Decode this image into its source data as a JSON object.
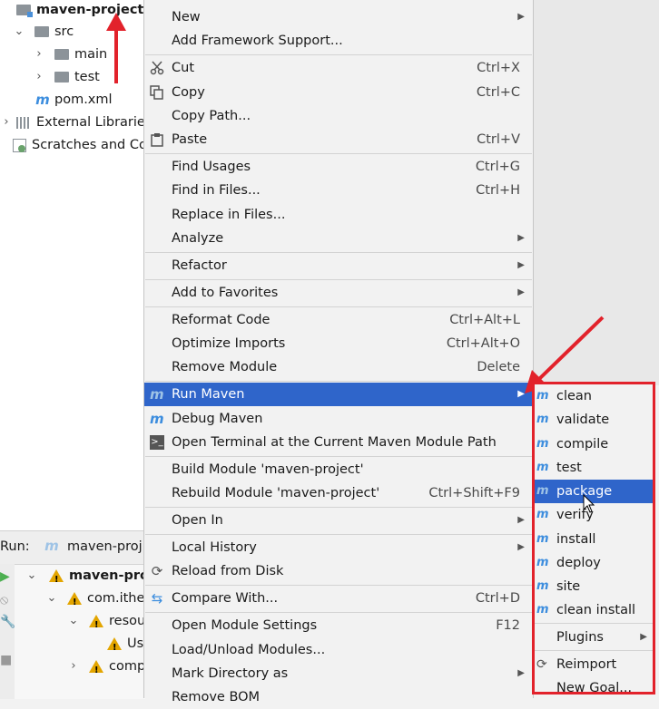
{
  "project_tree": {
    "root": "maven-project",
    "items": [
      {
        "label": "src"
      },
      {
        "label": "main"
      },
      {
        "label": "test"
      },
      {
        "label": "pom.xml"
      },
      {
        "label": "External Librarie"
      },
      {
        "label": "Scratches and Co"
      }
    ]
  },
  "run_panel": {
    "run_label": "Run:",
    "tab_label": "maven-proj",
    "tree": [
      "maven-pro",
      "com.ithe",
      "resou",
      "Us",
      "comp"
    ]
  },
  "context_menu": {
    "items": [
      {
        "label": "New",
        "shortcut": ""
      },
      {
        "label": "Add Framework Support...",
        "shortcut": ""
      },
      {
        "label": "Cut",
        "shortcut": "Ctrl+X"
      },
      {
        "label": "Copy",
        "shortcut": "Ctrl+C"
      },
      {
        "label": "Copy Path...",
        "shortcut": ""
      },
      {
        "label": "Paste",
        "shortcut": "Ctrl+V"
      },
      {
        "label": "Find Usages",
        "shortcut": "Ctrl+G"
      },
      {
        "label": "Find in Files...",
        "shortcut": "Ctrl+H"
      },
      {
        "label": "Replace in Files...",
        "shortcut": ""
      },
      {
        "label": "Analyze",
        "shortcut": ""
      },
      {
        "label": "Refactor",
        "shortcut": ""
      },
      {
        "label": "Add to Favorites",
        "shortcut": ""
      },
      {
        "label": "Reformat Code",
        "shortcut": "Ctrl+Alt+L"
      },
      {
        "label": "Optimize Imports",
        "shortcut": "Ctrl+Alt+O"
      },
      {
        "label": "Remove Module",
        "shortcut": "Delete"
      },
      {
        "label": "Run Maven",
        "shortcut": ""
      },
      {
        "label": "Debug Maven",
        "shortcut": ""
      },
      {
        "label": "Open Terminal at the Current Maven Module Path",
        "shortcut": ""
      },
      {
        "label": "Build Module 'maven-project'",
        "shortcut": ""
      },
      {
        "label": "Rebuild Module 'maven-project'",
        "shortcut": "Ctrl+Shift+F9"
      },
      {
        "label": "Open In",
        "shortcut": ""
      },
      {
        "label": "Local History",
        "shortcut": ""
      },
      {
        "label": "Reload from Disk",
        "shortcut": ""
      },
      {
        "label": "Compare With...",
        "shortcut": "Ctrl+D"
      },
      {
        "label": "Open Module Settings",
        "shortcut": "F12"
      },
      {
        "label": "Load/Unload Modules...",
        "shortcut": ""
      },
      {
        "label": "Mark Directory as",
        "shortcut": ""
      },
      {
        "label": "Remove BOM",
        "shortcut": ""
      }
    ]
  },
  "run_maven_submenu": {
    "goals": [
      "clean",
      "validate",
      "compile",
      "test",
      "package",
      "verify",
      "install",
      "deploy",
      "site",
      "clean install"
    ],
    "plugins_label": "Plugins",
    "reimport_label": "Reimport",
    "new_goal_label": "New Goal..."
  },
  "colors": {
    "selection": "#2f65ca",
    "annotation_red": "#e2222b",
    "maven_icon": "#3c8dde",
    "warning": "#e3a500"
  }
}
